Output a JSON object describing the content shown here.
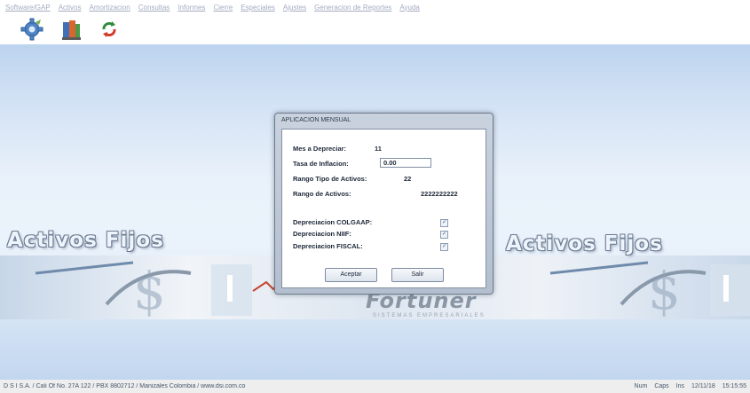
{
  "menu": {
    "items": [
      "Software/GAP",
      "Activos",
      "Amortizacion",
      "Consultas",
      "Informes",
      "Cierre",
      "Especiales",
      "Ajustes",
      "Generacion de Reportes",
      "Ayuda"
    ]
  },
  "toolbar": {
    "buttons": [
      {
        "icon": "settings-gear-icon"
      },
      {
        "icon": "books-icon"
      },
      {
        "icon": "refresh-icon"
      }
    ]
  },
  "background": {
    "brand_left": "Activos Fijos",
    "brand_right": "Activos Fijos",
    "center_brand": "Fortuner",
    "center_brand_sub": "SISTEMAS EMPRESARIALES"
  },
  "dialog": {
    "title": "APLICACION MENSUAL",
    "fields": {
      "mes_label": "Mes a Depreciar:",
      "mes_value": "11",
      "tasa_label": "Tasa de Inflacion:",
      "tasa_value": "0.00",
      "rango_tipo_label": "Rango Tipo de Activos:",
      "rango_tipo_value": "22",
      "rango_activos_label": "Rango de Activos:",
      "rango_activos_value": "2222222222"
    },
    "checks": {
      "colgaap_label": "Depreciacion COLGAAP:",
      "colgaap_checked": true,
      "niif_label": "Depreciacion NIIF:",
      "niif_checked": true,
      "fiscal_label": "Depreciacion FISCAL:",
      "fiscal_checked": true
    },
    "buttons": {
      "accept": "Aceptar",
      "exit": "Salir"
    }
  },
  "status": {
    "left": "D S I S.A. / Cali Of No. 27A 122 / PBX 8802712 / Manizales Colombia / www.dsi.com.co",
    "num": "Num",
    "caps": "Caps",
    "ins": "Ins",
    "date": "12/11/18",
    "time": "15:15:55"
  }
}
